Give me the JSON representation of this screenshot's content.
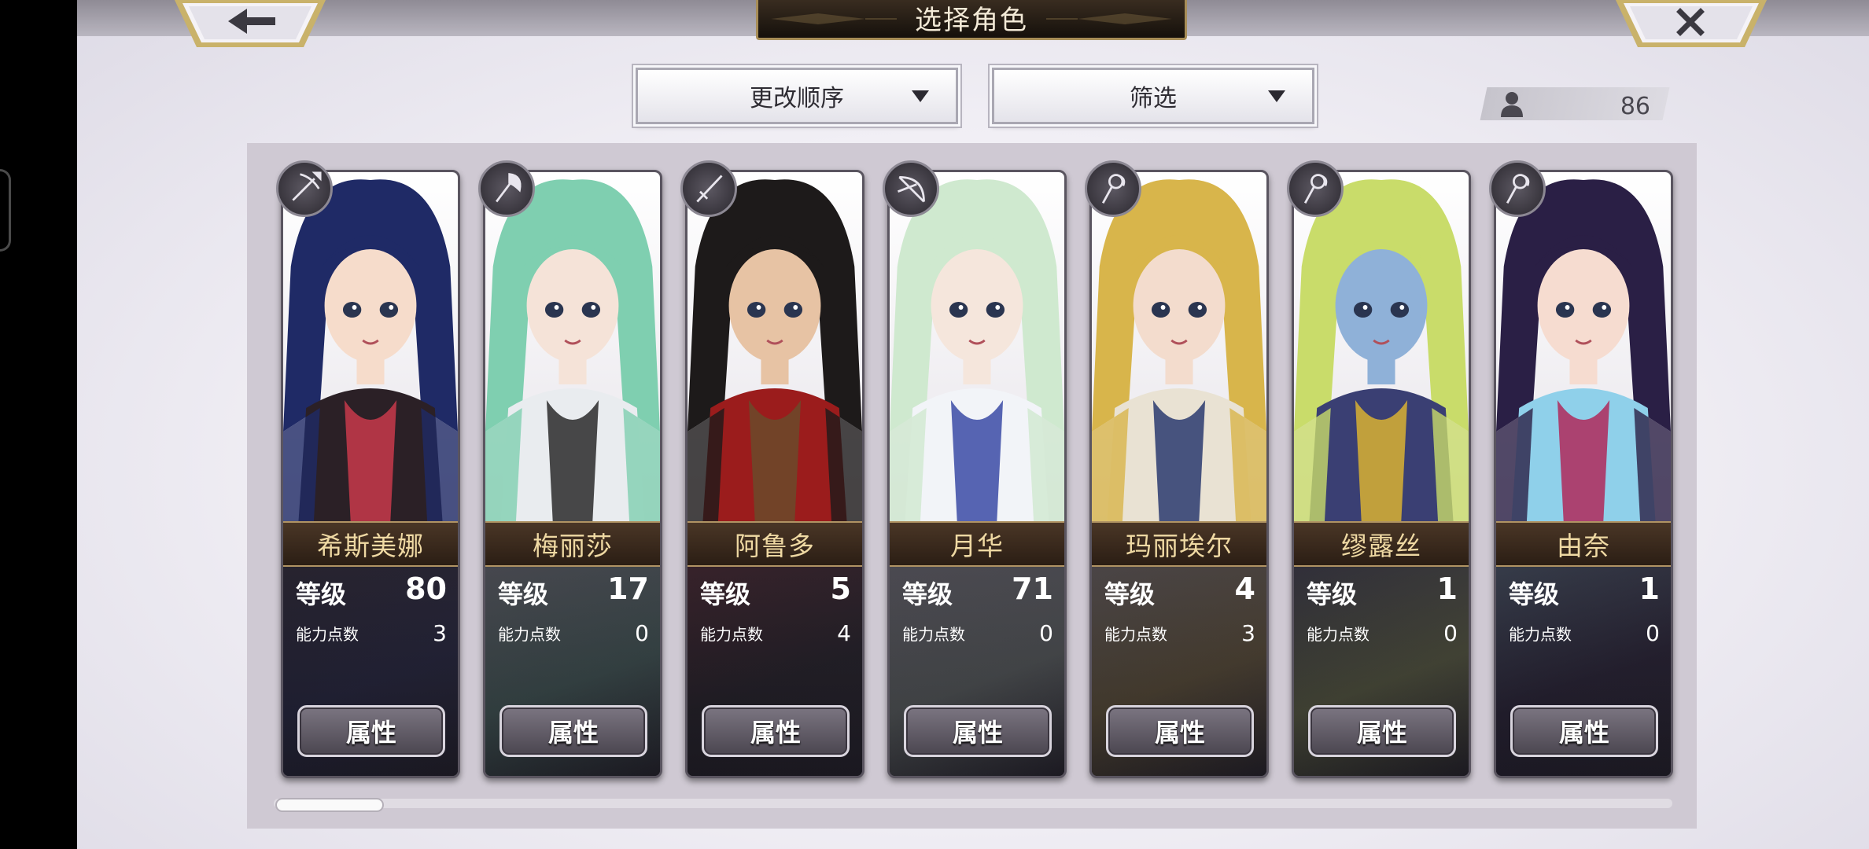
{
  "header": {
    "title": "选择角色",
    "back_icon": "arrow-left-icon",
    "close_icon": "close-icon"
  },
  "controls": {
    "sort_label": "更改顺序",
    "filter_label": "筛选",
    "roster_count": "86"
  },
  "attribute_button_label": "属性",
  "level_label": "等级",
  "ability_points_label": "能力点数",
  "characters": [
    {
      "name": "希斯美娜",
      "level": "80",
      "ability_points": "3",
      "class_icon": "crossbow-icon",
      "hair": "#1f2a66",
      "skin": "#f6dccb",
      "outfit": "#2b2026",
      "accent": "#c83a4b"
    },
    {
      "name": "梅丽莎",
      "level": "17",
      "ability_points": "0",
      "class_icon": "axe-icon",
      "hair": "#7fcfb0",
      "skin": "#f5e3d8",
      "outfit": "#e9ecef",
      "accent": "#2a2a2a"
    },
    {
      "name": "阿鲁多",
      "level": "5",
      "ability_points": "4",
      "class_icon": "sword-icon",
      "hair": "#1d1a1a",
      "skin": "#e7c3a4",
      "outfit": "#9b1c1c",
      "accent": "#6b4a2a"
    },
    {
      "name": "月华",
      "level": "71",
      "ability_points": "0",
      "class_icon": "bow-icon",
      "hair": "#cfe9cf",
      "skin": "#f5e6dc",
      "outfit": "#f2f4f8",
      "accent": "#3b4aa6"
    },
    {
      "name": "玛丽埃尔",
      "level": "4",
      "ability_points": "3",
      "class_icon": "staff-icon",
      "hair": "#d8b54b",
      "skin": "#f3dccd",
      "outfit": "#e9e2d3",
      "accent": "#2a3a6e"
    },
    {
      "name": "缪露丝",
      "level": "1",
      "ability_points": "0",
      "class_icon": "staff-icon",
      "hair": "#c9dc6a",
      "skin": "#8fb1d8",
      "outfit": "#3a3f73",
      "accent": "#d9b233"
    },
    {
      "name": "由奈",
      "level": "1",
      "ability_points": "0",
      "class_icon": "staff-icon",
      "hair": "#2a1f45",
      "skin": "#f6dcd0",
      "outfit": "#8fd0ea",
      "accent": "#b0295b"
    }
  ]
}
